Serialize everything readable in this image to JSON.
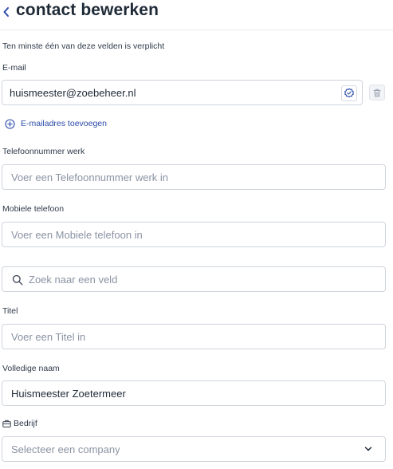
{
  "header": {
    "title": "contact bewerken",
    "back_icon": "chevron-left-icon"
  },
  "form": {
    "hint": "Ten minste één van deze velden is verplicht",
    "email": {
      "label": "E-mail",
      "value": "huismeester@zoebeheer.nl",
      "add_label": "E-mailadres toevoegen"
    },
    "work_phone": {
      "label": "Telefoonnummer werk",
      "placeholder": "Voer een Telefoonnummer werk in"
    },
    "mobile": {
      "label": "Mobiele telefoon",
      "placeholder": "Voer een Mobiele telefoon in"
    },
    "search": {
      "placeholder": "Zoek naar een veld"
    },
    "title_field": {
      "label": "Titel",
      "placeholder": "Voer een Titel in"
    },
    "full_name": {
      "label": "Volledige naam",
      "value": "Huismeester Zoetermeer"
    },
    "company": {
      "label": "Bedrijf",
      "placeholder": "Selecteer een company"
    }
  },
  "colors": {
    "accent": "#2b4aa8",
    "text": "#1f2a37",
    "border": "#cfd4dc",
    "placeholder": "#8a93a3"
  }
}
